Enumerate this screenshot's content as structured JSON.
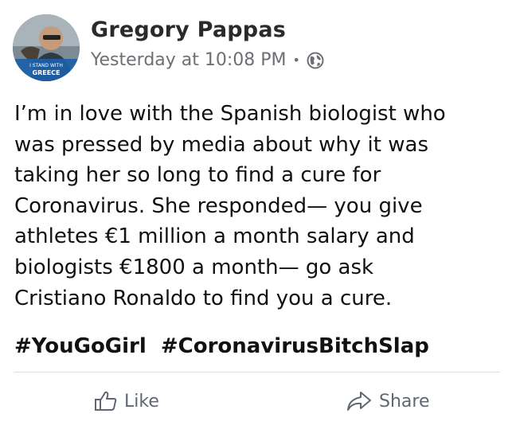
{
  "post": {
    "author": "Gregory Pappas",
    "timestamp": "Yesterday at 10:08 PM",
    "separator": "•",
    "privacy_icon": "globe-icon",
    "avatar": {
      "badge_line1": "I STAND WITH",
      "badge_line2": "GREECE"
    },
    "body": "I’m in love with the Spanish biologist who\nwas pressed by media about why it was\ntaking her so long to find a cure for\nCoronavirus. She responded— you give\nathletes €1 million a month salary and\nbiologists €1800 a month— go ask\nCristiano Ronaldo to find you a cure.",
    "hashtags": [
      "#YouGoGirl",
      "#CoronavirusBitchSlap"
    ]
  },
  "actions": {
    "like_label": "Like",
    "like_icon": "thumbs-up-icon",
    "share_label": "Share",
    "share_icon": "share-arrow-icon"
  }
}
